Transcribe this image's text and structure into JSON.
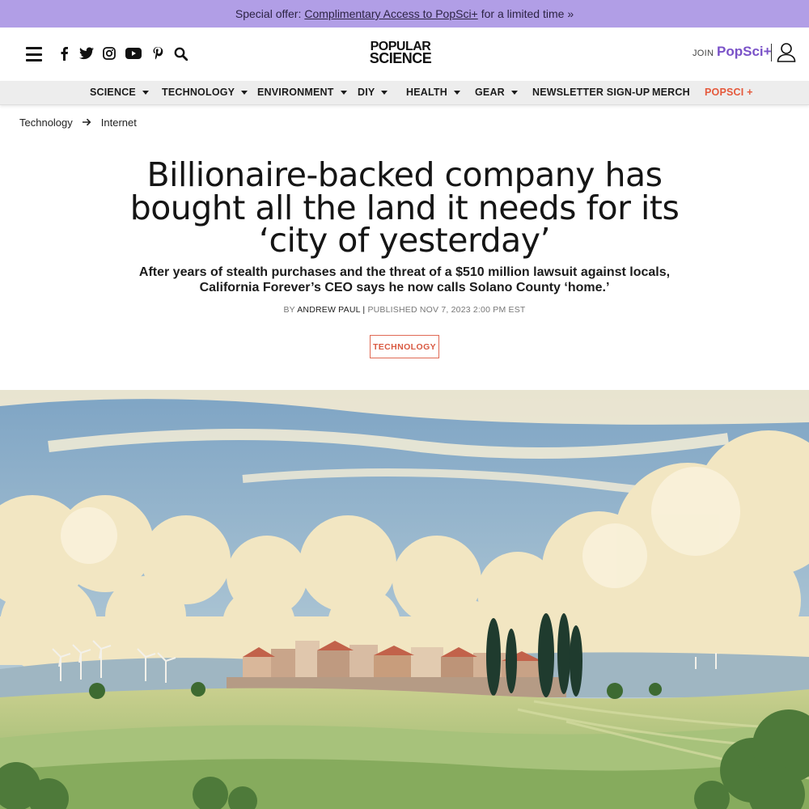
{
  "promo": {
    "prefix": "Special offer:",
    "link": "Complimentary Access to PopSci+",
    "suffix": "for a limited time »"
  },
  "header": {
    "logo_line1": "POPULAR",
    "logo_line2": "SCIENCE",
    "join": "JOIN",
    "popsci_plus": "PopSci+",
    "social_icons": [
      "facebook-icon",
      "twitter-icon",
      "instagram-icon",
      "youtube-icon",
      "pinterest-icon",
      "search-icon"
    ]
  },
  "nav": {
    "items": [
      "SCIENCE",
      "TECHNOLOGY",
      "ENVIRONMENT",
      "DIY",
      "HEALTH",
      "GEAR",
      "NEWSLETTER SIGN-UP",
      "MERCH",
      "POPSCI +"
    ]
  },
  "breadcrumb": {
    "items": [
      "Technology",
      "Internet"
    ]
  },
  "article": {
    "title_line1": "Billionaire-backed company has",
    "title_line2": "bought all the land it needs for its",
    "title_line3": "‘city of yesterday’",
    "dek_line1": "After years of stealth purchases and the threat of a $510 million lawsuit against locals,",
    "dek_line2": "California Forever’s CEO says he now calls Solano County ‘home.’",
    "by": "BY",
    "author": "ANDREW PAUL",
    "sep": "|",
    "published": "PUBLISHED NOV 7, 2023 2:00 PM EST",
    "tag": "TECHNOLOGY"
  },
  "colors": {
    "promo_bg": "#b19ee6",
    "accent": "#e5593c",
    "popsci_purple": "#7a52c8"
  }
}
